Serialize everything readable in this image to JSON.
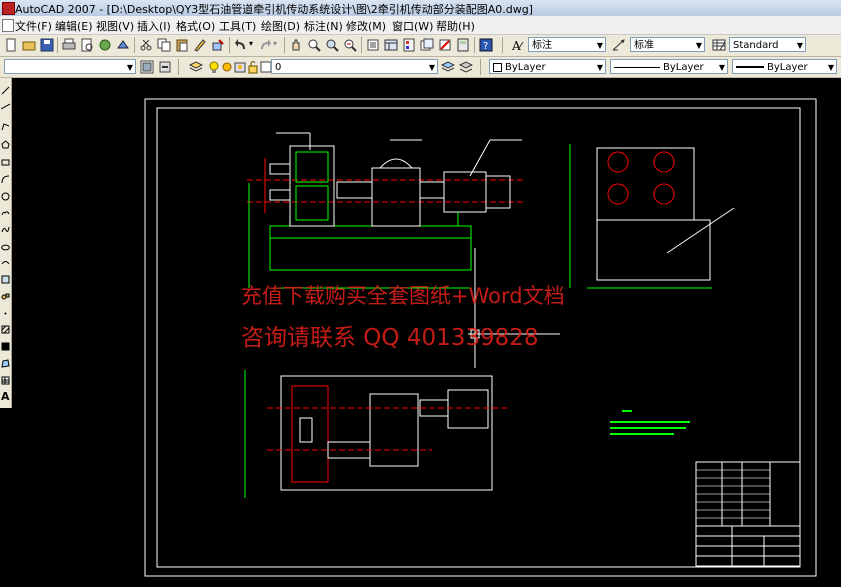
{
  "window": {
    "title": "AutoCAD 2007 - [D:\\Desktop\\QY3型石油管道牵引机传动系统设计\\图\\2牵引机传动部分装配图A0.dwg]"
  },
  "menu": {
    "items": [
      "文件(F)",
      "编辑(E)",
      "视图(V)",
      "插入(I)",
      "格式(O)",
      "工具(T)",
      "绘图(D)",
      "标注(N)",
      "修改(M)",
      "窗口(W)",
      "帮助(H)"
    ]
  },
  "styles_toolbar": {
    "text_style": "标注",
    "dim_style": "标准",
    "table_style": "Standard"
  },
  "layers_toolbar": {
    "layer_name": "0"
  },
  "properties_toolbar": {
    "color": "ByLayer",
    "linetype": "ByLayer",
    "lineweight": "ByLayer"
  },
  "left_toolbar": {
    "text_tool_label": "A"
  },
  "watermark": {
    "line1": "充值下载购买全套图纸+Word文档",
    "line2": "咨询请联系 QQ 401339828"
  },
  "colors": {
    "canvas": "#000000",
    "border": "#ffffff",
    "green": "#00ff00",
    "red": "#ff0000",
    "yellow": "#ffff00",
    "cyan": "#00ffff",
    "watermark": "#e0201a"
  }
}
